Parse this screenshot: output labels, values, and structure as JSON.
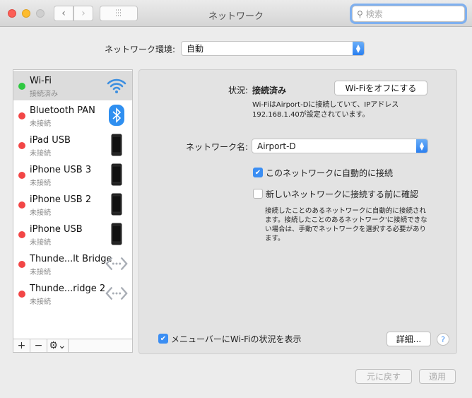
{
  "window": {
    "title": "ネットワーク",
    "search_placeholder": "検索",
    "back": "‹",
    "forward": "›",
    "grid": "⋯"
  },
  "location": {
    "label": "ネットワーク環境:",
    "value": "自動"
  },
  "services": [
    {
      "name": "Wi-Fi",
      "status": "接続済み",
      "state": "connected",
      "icon": "wifi-icon"
    },
    {
      "name": "Bluetooth PAN",
      "status": "未接続",
      "state": "disconnected",
      "icon": "bluetooth-icon"
    },
    {
      "name": "iPad USB",
      "status": "未接続",
      "state": "disconnected",
      "icon": "device-icon"
    },
    {
      "name": "iPhone USB 3",
      "status": "未接続",
      "state": "disconnected",
      "icon": "device-icon"
    },
    {
      "name": "iPhone USB 2",
      "status": "未接続",
      "state": "disconnected",
      "icon": "device-icon"
    },
    {
      "name": "iPhone USB",
      "status": "未接続",
      "state": "disconnected",
      "icon": "device-icon"
    },
    {
      "name": "Thunde...lt Bridge",
      "status": "未接続",
      "state": "disconnected",
      "icon": "bridge-icon"
    },
    {
      "name": "Thunde...ridge 2",
      "status": "未接続",
      "state": "disconnected",
      "icon": "bridge-icon"
    }
  ],
  "sidebar_toolbar": {
    "add": "+",
    "remove": "−",
    "gear": "⚙⌄"
  },
  "detail": {
    "status_label": "状況:",
    "status_value": "接続済み",
    "wifi_off_button": "Wi-Fiをオフにする",
    "status_desc_1": "Wi-FiはAirport-Dに接続していて、IPアドレス",
    "status_desc_2": "192.168.1.40が設定されています。",
    "network_name_label": "ネットワーク名:",
    "network_name_value": "Airport-D",
    "auto_join_label": "このネットワークに自動的に接続",
    "auto_join_checked": true,
    "ask_join_label": "新しいネットワークに接続する前に確認",
    "ask_join_checked": false,
    "ask_desc_1": "接続したことのあるネットワークに自動的に接続され",
    "ask_desc_2": "ます。接続したことのあるネットワーク'に接続できな",
    "ask_desc_3": "い場合は、手動でネットワークを選択する必要があり",
    "ask_desc_4": "ます。",
    "menubar_label": "メニューバーにWi-Fiの状況を表示",
    "menubar_checked": true,
    "advanced_button": "詳細...",
    "help": "?"
  },
  "footer": {
    "revert": "元に戻す",
    "apply": "適用"
  },
  "colors": {
    "connected": "#2ec840",
    "disconnected": "#f24646",
    "accent": "#3b8ef3"
  }
}
